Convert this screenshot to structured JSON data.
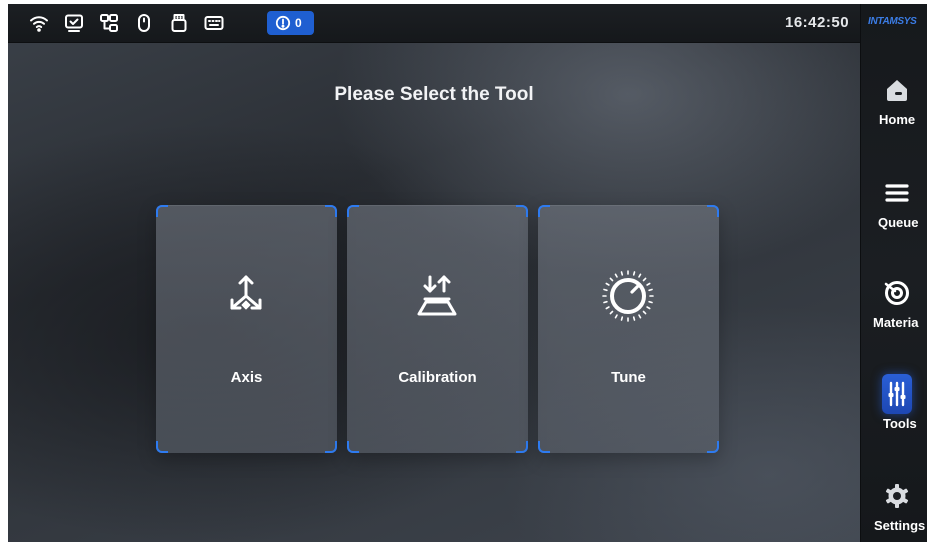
{
  "status_bar": {
    "icons": [
      "wifi-icon",
      "monitor-icon",
      "network-icon",
      "mouse-icon",
      "usb-drive-icon",
      "keyboard-icon"
    ],
    "alert_icon": "alert-icon",
    "alert_count": "0",
    "clock": "16:42:50"
  },
  "sidebar": {
    "brand": "INTAMSYS",
    "items": [
      {
        "label": "Home",
        "icon": "home-icon"
      },
      {
        "label": "Queue",
        "icon": "queue-icon"
      },
      {
        "label": "Materia",
        "icon": "material-icon"
      },
      {
        "label": "Tools",
        "icon": "tools-icon",
        "active": true
      },
      {
        "label": "Settings",
        "icon": "settings-icon"
      }
    ]
  },
  "main": {
    "title": "Please Select the Tool",
    "tools": [
      {
        "label": "Axis",
        "icon": "axis-icon"
      },
      {
        "label": "Calibration",
        "icon": "calibration-icon"
      },
      {
        "label": "Tune",
        "icon": "tune-knob-icon"
      }
    ]
  },
  "colors": {
    "accent": "#2e7bf0",
    "alert_badge": "#1f5fd1",
    "text": "#ffffff"
  }
}
